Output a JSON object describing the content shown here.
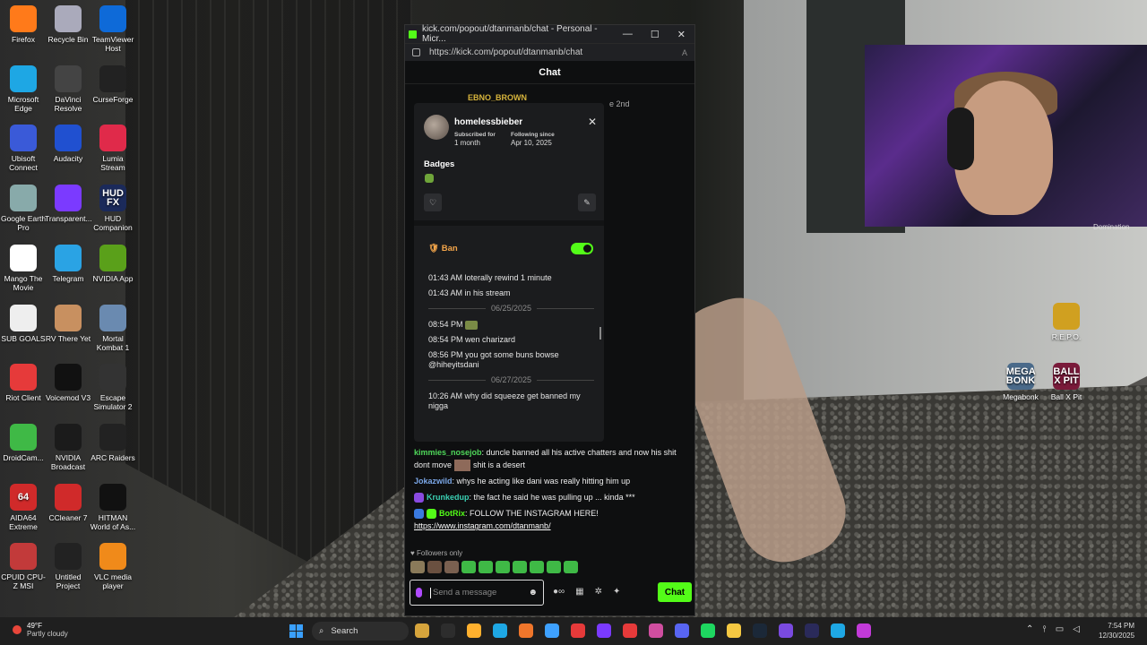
{
  "desktop_icons_col1": [
    "Firefox",
    "Microsoft Edge",
    "Ubisoft Connect",
    "Google Earth Pro",
    "Mango The Movie",
    "SUB GOALS",
    "Riot Client",
    "DroidCam...",
    "AIDA64 Extreme",
    "CPUID CPU-Z MSI"
  ],
  "desktop_icons_col2": [
    "Recycle Bin",
    "DaVinci Resolve",
    "Audacity",
    "Transparent...",
    "Telegram",
    "RV There Yet",
    "Voicemod V3",
    "NVIDIA Broadcast",
    "CCleaner 7",
    "Untitled Project"
  ],
  "desktop_icons_col3": [
    "TeamViewer Host",
    "CurseForge",
    "Lumia Stream",
    "HUD Companion",
    "NVIDIA App",
    "Mortal Kombat 1",
    "Escape Simulator 2",
    "ARC Raiders",
    "HITMAN World of As...",
    "VLC media player"
  ],
  "desktop_icons_right": [
    "R.E.P.O.",
    "Megabonk",
    "Ball X Pit"
  ],
  "icon_texts": {
    "hud": "HUD FX",
    "megabonk": "MEGA BONK",
    "ballxpit": "BALL X PIT",
    "aida": "64"
  },
  "cam_label": "Domination",
  "browser": {
    "title": "kick.com/popout/dtanmanb/chat - Personal - Micr...",
    "url": "https://kick.com/popout/dtanmanb/chat",
    "header": "Chat",
    "behind_name": "EBNO_BROWN",
    "behind_text": "e 2nd"
  },
  "user_card": {
    "username": "homelessbieber",
    "subscribed_label": "Subscribed for",
    "subscribed_value": "1 month",
    "following_label": "Following since",
    "following_value": "Apr 10, 2025",
    "badges_heading": "Badges",
    "ban_label": "Ban",
    "ban_enabled": true,
    "history": [
      {
        "type": "msg",
        "time": "01:43 AM",
        "text": "loterally rewind 1 minute"
      },
      {
        "type": "msg",
        "time": "01:43 AM",
        "text": "in his stream"
      },
      {
        "type": "date",
        "text": "06/25/2025"
      },
      {
        "type": "msg",
        "time": "08:54 PM",
        "text": ""
      },
      {
        "type": "msg",
        "time": "08:54 PM",
        "text": "wen charizard"
      },
      {
        "type": "msg",
        "time": "08:56 PM",
        "text": "you got some buns bowse @hiheyitsdani"
      },
      {
        "type": "date",
        "text": "06/27/2025"
      },
      {
        "type": "msg",
        "time": "10:26 AM",
        "text": "why did squeeze get banned my nigga"
      }
    ]
  },
  "chat": [
    {
      "user": "kimmies_nosejob",
      "class": "u-green",
      "text_a": "duncle banned all his active chatters and now his shit dont move",
      "text_b": "shit is a desert"
    },
    {
      "user": "Jokazwild",
      "class": "u-blue",
      "text": "whys he acting like dani was really hitting him up"
    },
    {
      "user": "Krunkedup",
      "class": "u-teal",
      "text": "the fact he said he was pulling up ... kinda ***"
    },
    {
      "user": "BotRix",
      "class": "u-bot",
      "text": "FOLLOW THE INSTAGRAM HERE!",
      "link": "https://www.instagram.com/dtanmanb/"
    }
  ],
  "followers_only": "Followers only",
  "input_placeholder": "Send a message",
  "chat_button": "Chat",
  "taskbar": {
    "weather_temp": "49°F",
    "weather_desc": "Partly cloudy",
    "search_label": "Search",
    "time": "7:54 PM",
    "date": "12/30/2025",
    "icon_colors": [
      "#d6a43c",
      "#2d2d2d",
      "#ffb02e",
      "#1ea7e4",
      "#f0762b",
      "#3ea1ff",
      "#e63a3a",
      "#7b3aff",
      "#e63a3a",
      "#d04ea0",
      "#5865f2",
      "#1ed760",
      "#f5c842",
      "#1b2838",
      "#7a4ae0",
      "#2a2a5a",
      "#1ea7e4",
      "#c23ad8"
    ]
  }
}
